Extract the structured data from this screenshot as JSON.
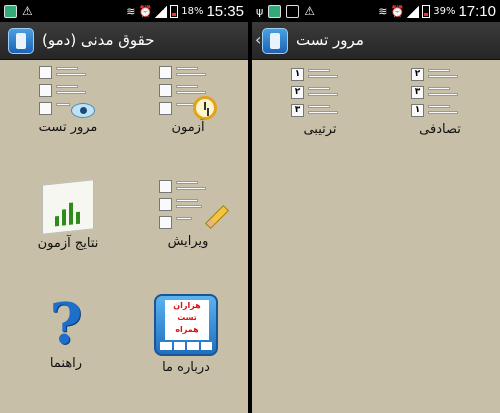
{
  "left_screen": {
    "statusbar": {
      "icons": [
        "gallery-icon",
        "warning-icon",
        "wifi-icon",
        "alarm-icon",
        "signal-icon",
        "battery-icon"
      ],
      "battery": "18%",
      "time": "15:35"
    },
    "actionbar": {
      "title": "حقوق مدنی (دمو)"
    },
    "tiles": [
      {
        "label": "آزمون",
        "icon": "list-clock-icon"
      },
      {
        "label": "مرور تست",
        "icon": "list-eye-icon"
      },
      {
        "label": "ویرایش",
        "icon": "list-pencil-icon"
      },
      {
        "label": "نتایج آزمون",
        "icon": "chart-icon"
      },
      {
        "label": "درباره ما",
        "icon": "about-badge-icon",
        "badge_text": [
          "هزاران",
          "تست",
          "همراه"
        ]
      },
      {
        "label": "راهنما",
        "icon": "question-icon"
      }
    ]
  },
  "right_screen": {
    "statusbar": {
      "icons": [
        "usb-icon",
        "gallery-icon",
        "image-icon",
        "warning-icon",
        "wifi-icon",
        "alarm-icon",
        "signal-icon",
        "battery-icon"
      ],
      "battery": "39%",
      "time": "17:10"
    },
    "actionbar": {
      "title": "مرور تست"
    },
    "tiles": [
      {
        "label": "تصادفی",
        "icon": "random-order-icon",
        "numbers": [
          "۲",
          "۳",
          "۱"
        ]
      },
      {
        "label": "ترتیبی",
        "icon": "sequential-order-icon",
        "numbers": [
          "۱",
          "۲",
          "۳"
        ]
      }
    ]
  }
}
